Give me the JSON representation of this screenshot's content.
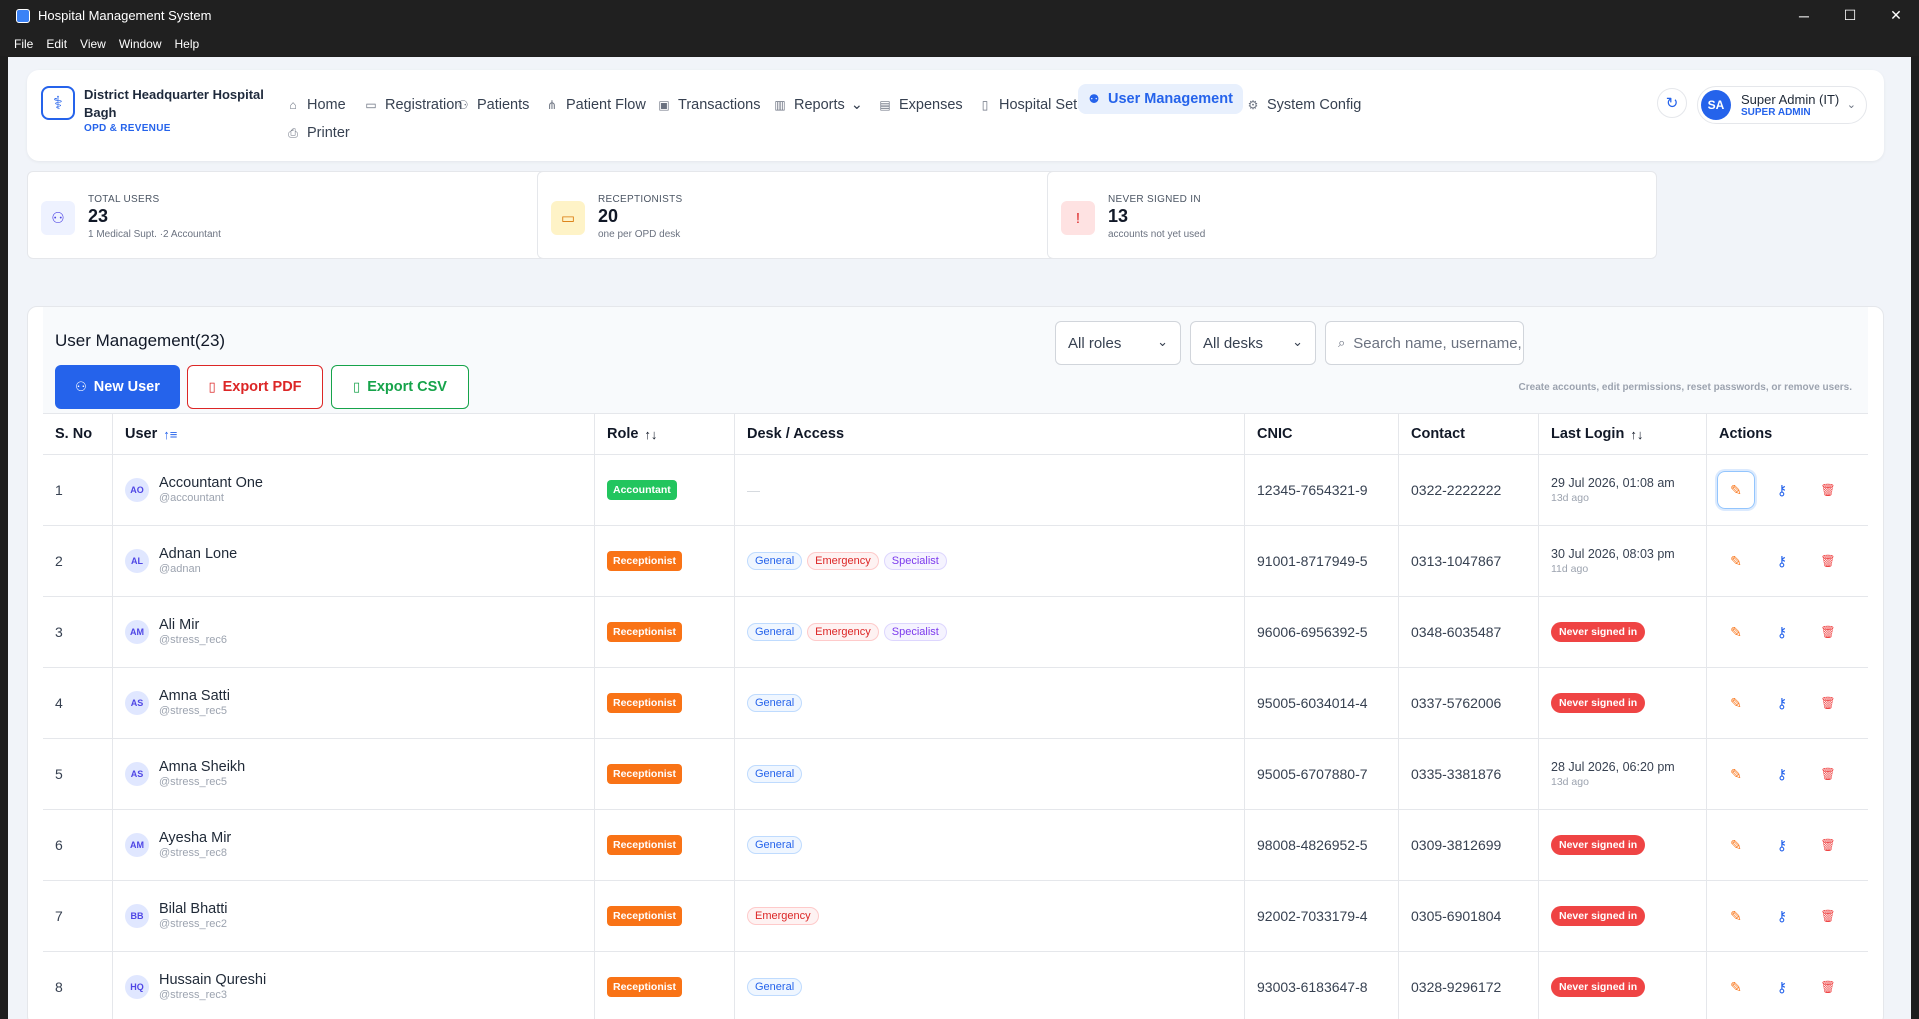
{
  "window": {
    "title": "Hospital Management System",
    "minimize": "─",
    "maximize": "☐",
    "close": "✕"
  },
  "menu": [
    "File",
    "Edit",
    "View",
    "Window",
    "Help"
  ],
  "brand": {
    "name": "District Headquarter Hospital Bagh",
    "sub": "OPD & REVENUE"
  },
  "nav": [
    {
      "label": "Home",
      "icon": "home-icon",
      "glyph": "⌂"
    },
    {
      "label": "Registration",
      "icon": "id-card-icon",
      "glyph": "▭"
    },
    {
      "label": "Patients",
      "icon": "users-icon",
      "glyph": "⚇"
    },
    {
      "label": "Patient Flow",
      "icon": "flow-icon",
      "glyph": "⋔"
    },
    {
      "label": "Transactions",
      "icon": "wallet-icon",
      "glyph": "▣"
    },
    {
      "label": "Reports",
      "icon": "chart-icon",
      "glyph": "▥"
    },
    {
      "label": "Expenses",
      "icon": "receipt-icon",
      "glyph": "▤"
    },
    {
      "label": "Hospital Setup",
      "icon": "building-icon",
      "glyph": "▯"
    },
    {
      "label": "User Management",
      "icon": "user-cog-icon",
      "glyph": "⚉"
    },
    {
      "label": "System Config",
      "icon": "gear-icon",
      "glyph": "⚙"
    },
    {
      "label": "Printer",
      "icon": "printer-icon",
      "glyph": "⎙"
    }
  ],
  "profile": {
    "initials": "SA",
    "name": "Super Admin (IT)",
    "role": "SUPER ADMIN"
  },
  "stats": [
    {
      "label": "TOTAL USERS",
      "value": "23",
      "sub": "1 Medical Supt. ·2 Accountant",
      "icon": "users-icon",
      "color": "#eef2ff",
      "fg": "#4f46e5",
      "glyph": "⚇"
    },
    {
      "label": "RECEPTIONISTS",
      "value": "20",
      "sub": "one per OPD desk",
      "icon": "id-card-icon",
      "color": "#fef3c7",
      "fg": "#d97706",
      "glyph": "▭"
    },
    {
      "label": "NEVER SIGNED IN",
      "value": "13",
      "sub": "accounts not yet used",
      "icon": "alert-circle-icon",
      "color": "#fee2e2",
      "fg": "#dc2626",
      "glyph": "!"
    }
  ],
  "panel": {
    "title": "User Management(23)",
    "new_user": "New User",
    "export_pdf": "Export PDF",
    "export_csv": "Export CSV",
    "roles_filter": "All roles",
    "desks_filter": "All desks",
    "search_placeholder": "Search name, username, CNIC",
    "hint": "Create accounts, edit permissions, reset passwords, or remove users."
  },
  "columns": {
    "sno": "S. No",
    "user": "User",
    "role": "Role",
    "desk": "Desk / Access",
    "cnic": "CNIC",
    "contact": "Contact",
    "last_login": "Last Login",
    "actions": "Actions"
  },
  "never_label": "Never signed in",
  "rows": [
    {
      "sno": "1",
      "initials": "AO",
      "name": "Accountant One",
      "handle": "@accountant",
      "role": "Accountant",
      "role_kind": "acc",
      "desks": [],
      "dash": "—",
      "cnic": "12345-7654321-9",
      "contact": "0322-2222222",
      "login": "29 Jul 2026, 01:08 am",
      "ago": "13d ago"
    },
    {
      "sno": "2",
      "initials": "AL",
      "name": "Adnan Lone",
      "handle": "@adnan",
      "role": "Receptionist",
      "role_kind": "rec",
      "desks": [
        "General",
        "Emergency",
        "Specialist"
      ],
      "cnic": "91001-8717949-5",
      "contact": "0313-1047867",
      "login": "30 Jul 2026, 08:03 pm",
      "ago": "11d ago"
    },
    {
      "sno": "3",
      "initials": "AM",
      "name": "Ali Mir",
      "handle": "@stress_rec6",
      "role": "Receptionist",
      "role_kind": "rec",
      "desks": [
        "General",
        "Emergency",
        "Specialist"
      ],
      "cnic": "96006-6956392-5",
      "contact": "0348-6035487",
      "login": null,
      "ago": null
    },
    {
      "sno": "4",
      "initials": "AS",
      "name": "Amna Satti",
      "handle": "@stress_rec5",
      "role": "Receptionist",
      "role_kind": "rec",
      "desks": [
        "General"
      ],
      "cnic": "95005-6034014-4",
      "contact": "0337-5762006",
      "login": null,
      "ago": null
    },
    {
      "sno": "5",
      "initials": "AS",
      "name": "Amna Sheikh",
      "handle": "@stress_rec5",
      "role": "Receptionist",
      "role_kind": "rec",
      "desks": [
        "General"
      ],
      "cnic": "95005-6707880-7",
      "contact": "0335-3381876",
      "login": "28 Jul 2026, 06:20 pm",
      "ago": "13d ago"
    },
    {
      "sno": "6",
      "initials": "AM",
      "name": "Ayesha Mir",
      "handle": "@stress_rec8",
      "role": "Receptionist",
      "role_kind": "rec",
      "desks": [
        "General"
      ],
      "cnic": "98008-4826952-5",
      "contact": "0309-3812699",
      "login": null,
      "ago": null
    },
    {
      "sno": "7",
      "initials": "BB",
      "name": "Bilal Bhatti",
      "handle": "@stress_rec2",
      "role": "Receptionist",
      "role_kind": "rec",
      "desks": [
        "Emergency"
      ],
      "cnic": "92002-7033179-4",
      "contact": "0305-6901804",
      "login": null,
      "ago": null
    },
    {
      "sno": "8",
      "initials": "HQ",
      "name": "Hussain Qureshi",
      "handle": "@stress_rec3",
      "role": "Receptionist",
      "role_kind": "rec",
      "desks": [
        "General"
      ],
      "cnic": "93003-6183647-8",
      "contact": "0328-9296172",
      "login": null,
      "ago": null
    }
  ]
}
